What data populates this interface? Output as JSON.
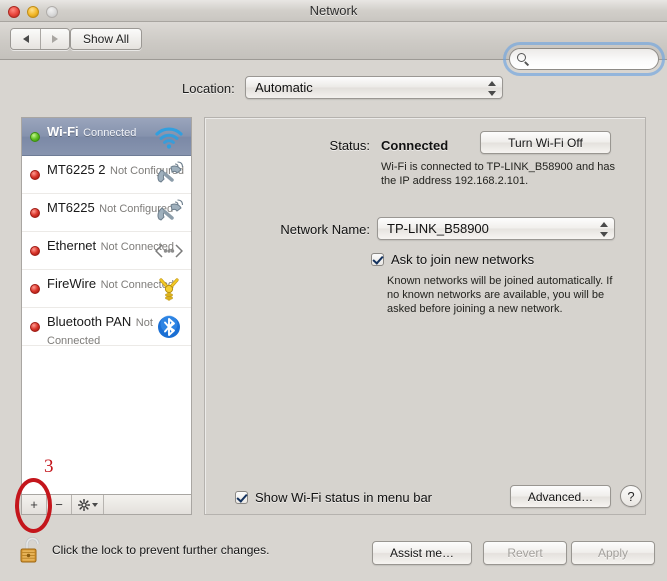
{
  "window": {
    "title": "Network",
    "traffic_lights": [
      "close",
      "minimize",
      "zoom"
    ]
  },
  "toolbar": {
    "back_icon": "chevron-left-icon",
    "forward_icon": "chevron-right-icon",
    "show_all_label": "Show All",
    "search_placeholder": "",
    "search_value": "",
    "search_icon": "search-icon"
  },
  "location": {
    "label": "Location:",
    "value": "Automatic",
    "options": [
      "Automatic"
    ]
  },
  "sidebar": {
    "services": [
      {
        "name": "Wi-Fi",
        "status": "Connected",
        "dot": "green",
        "icon": "wifi-icon",
        "selected": true
      },
      {
        "name": "MT6225  2",
        "status": "Not Configured",
        "dot": "red",
        "icon": "modem-handset-icon",
        "selected": false
      },
      {
        "name": "MT6225",
        "status": "Not Configured",
        "dot": "red",
        "icon": "modem-handset-icon",
        "selected": false
      },
      {
        "name": "Ethernet",
        "status": "Not Connected",
        "dot": "red",
        "icon": "ethernet-icon",
        "selected": false
      },
      {
        "name": "FireWire",
        "status": "Not Connected",
        "dot": "red",
        "icon": "firewire-icon",
        "selected": false
      },
      {
        "name": "Bluetooth PAN",
        "status": "Not Connected",
        "dot": "red",
        "icon": "bluetooth-icon",
        "selected": false
      }
    ],
    "toolbar": {
      "add_label": "+",
      "remove_label": "−",
      "action_icon": "gear-icon",
      "action_caret": "chevron-down-icon"
    }
  },
  "detail": {
    "status_label": "Status:",
    "status_value": "Connected",
    "turn_off_label": "Turn Wi-Fi Off",
    "status_description": "Wi-Fi is connected to TP-LINK_B58900 and has the IP address 192.168.2.101.",
    "network_name_label": "Network Name:",
    "network_name_value": "TP-LINK_B58900",
    "ask_to_join_label": "Ask to join new networks",
    "ask_to_join_checked": true,
    "ask_to_join_description": "Known networks will be joined automatically. If no known networks are available, you will be asked before joining a new network.",
    "show_status_label": "Show Wi-Fi status in menu bar",
    "show_status_checked": true,
    "advanced_label": "Advanced…",
    "help_label": "?"
  },
  "bottom": {
    "lock_icon": "unlocked-padlock-icon",
    "lock_text": "Click the lock to prevent further changes.",
    "assist_label": "Assist me…",
    "revert_label": "Revert",
    "apply_label": "Apply",
    "revert_disabled": true,
    "apply_disabled": true
  },
  "annotation": {
    "number": "3",
    "color": "#c4161c",
    "target": "add-service-button"
  }
}
